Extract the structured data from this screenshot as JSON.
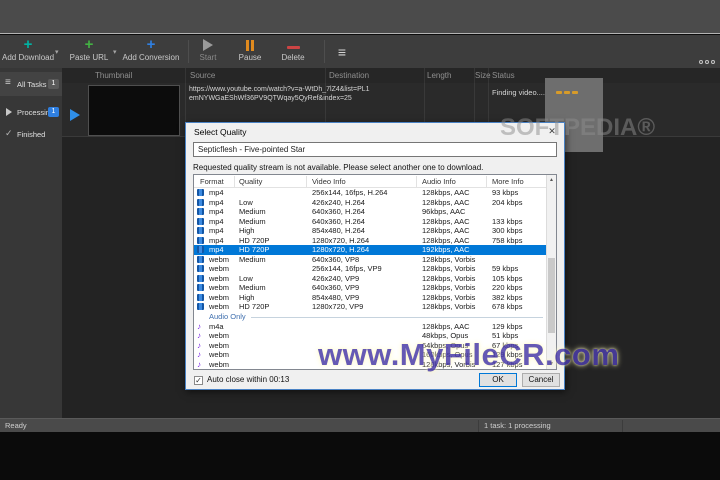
{
  "icons": {
    "plus": "+",
    "caret_down": "▾",
    "hamburger": "≡",
    "check": "✓",
    "close": "✕",
    "arrow_up": "▲",
    "arrow_down": "▼",
    "music_note": "♪",
    "checkbox_check": "✓"
  },
  "colors": {
    "add_download": "#00b3a4",
    "paste_url": "#43b143",
    "add_conversion": "#2f7fe0",
    "start_disabled": "#9a9a9a",
    "pause": "#e08a1e",
    "delete": "#cc4444",
    "selection": "#0078d7",
    "processing_badge": "#2f7fe0",
    "all_tasks_badge": "#5a5a5a",
    "play_overlay": "#2f8fe8",
    "loading_dots": "#d79b29",
    "watermark_blue": "#4b3da8"
  },
  "toolbar": {
    "buttons": [
      {
        "label": "Add Download"
      },
      {
        "label": "Paste URL"
      },
      {
        "label": "Add Conversion"
      },
      {
        "label": "Start",
        "disabled": true
      },
      {
        "label": "Pause"
      },
      {
        "label": "Delete"
      }
    ]
  },
  "sidebar": {
    "items": [
      {
        "label": "All Tasks",
        "badge": "1"
      },
      {
        "label": "Processing",
        "badge": "1"
      },
      {
        "label": "Finished",
        "badge": ""
      }
    ]
  },
  "task_table": {
    "columns": [
      "Thumbnail",
      "Source",
      "Destination",
      "Length",
      "Size",
      "Status"
    ],
    "row": {
      "source": "https://www.youtube.com/watch?v=a-WtDh_7lZ4&list=PL1emNYWGaEShWf36PV9QTWqay5QyRef&index=25",
      "status": "Finding video...."
    }
  },
  "dialog": {
    "title": "Select Quality",
    "video_title": "Septicflesh - Five-pointed Star",
    "message": "Requested quality stream is not available. Please select another one to download.",
    "table": {
      "columns": [
        "Format",
        "Quality",
        "Video Info",
        "Audio Info",
        "More Info"
      ],
      "video_rows": [
        {
          "format": "mp4",
          "quality": "",
          "video_info": "256x144, 16fps, H.264",
          "audio_info": "128kbps, AAC",
          "more_info": "93 kbps",
          "selected": false
        },
        {
          "format": "mp4",
          "quality": "Low",
          "video_info": "426x240, H.264",
          "audio_info": "128kbps, AAC",
          "more_info": "204 kbps",
          "selected": false
        },
        {
          "format": "mp4",
          "quality": "Medium",
          "video_info": "640x360, H.264",
          "audio_info": "96kbps, AAC",
          "more_info": "",
          "selected": false
        },
        {
          "format": "mp4",
          "quality": "Medium",
          "video_info": "640x360, H.264",
          "audio_info": "128kbps, AAC",
          "more_info": "133 kbps",
          "selected": false
        },
        {
          "format": "mp4",
          "quality": "High",
          "video_info": "854x480, H.264",
          "audio_info": "128kbps, AAC",
          "more_info": "300 kbps",
          "selected": false
        },
        {
          "format": "mp4",
          "quality": "HD 720P",
          "video_info": "1280x720, H.264",
          "audio_info": "128kbps, AAC",
          "more_info": "758 kbps",
          "selected": false
        },
        {
          "format": "mp4",
          "quality": "HD 720P",
          "video_info": "1280x720, H.264",
          "audio_info": "192kbps, AAC",
          "more_info": "",
          "selected": true
        },
        {
          "format": "webm",
          "quality": "Medium",
          "video_info": "640x360, VP8",
          "audio_info": "128kbps, Vorbis",
          "more_info": "",
          "selected": false
        },
        {
          "format": "webm",
          "quality": "",
          "video_info": "256x144, 16fps, VP9",
          "audio_info": "128kbps, Vorbis",
          "more_info": "59 kbps",
          "selected": false
        },
        {
          "format": "webm",
          "quality": "Low",
          "video_info": "426x240, VP9",
          "audio_info": "128kbps, Vorbis",
          "more_info": "105 kbps",
          "selected": false
        },
        {
          "format": "webm",
          "quality": "Medium",
          "video_info": "640x360, VP9",
          "audio_info": "128kbps, Vorbis",
          "more_info": "220 kbps",
          "selected": false
        },
        {
          "format": "webm",
          "quality": "High",
          "video_info": "854x480, VP9",
          "audio_info": "128kbps, Vorbis",
          "more_info": "382 kbps",
          "selected": false
        },
        {
          "format": "webm",
          "quality": "HD 720P",
          "video_info": "1280x720, VP9",
          "audio_info": "128kbps, Vorbis",
          "more_info": "678 kbps",
          "selected": false
        }
      ],
      "audio_section_label": "Audio Only",
      "audio_rows": [
        {
          "format": "m4a",
          "audio_info": "128kbps, AAC",
          "more_info": "129 kbps"
        },
        {
          "format": "webm",
          "audio_info": "48kbps, Opus",
          "more_info": "51 kbps"
        },
        {
          "format": "webm",
          "audio_info": "64kbps, Opus",
          "more_info": "67 kbps"
        },
        {
          "format": "webm",
          "audio_info": "160kbps, Opus",
          "more_info": "129 kbps"
        },
        {
          "format": "webm",
          "audio_info": "128kbps, Vorbis",
          "more_info": "127 kbps"
        }
      ]
    },
    "auto_close_label": "Auto close within 00:13",
    "auto_close_checked": true,
    "ok_label": "OK",
    "cancel_label": "Cancel"
  },
  "status_bar": {
    "left": "Ready",
    "tasks": "1 task: 1 processing"
  },
  "watermarks": {
    "softpedia": "SOFTPEDIA®",
    "myfilecr": "www.MyFileCR.com"
  }
}
